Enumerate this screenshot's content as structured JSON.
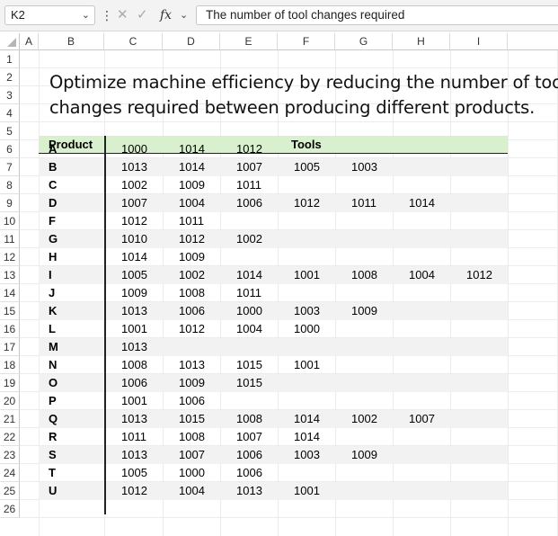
{
  "formula_bar": {
    "name_box": "K2",
    "formula": "The number of tool changes required",
    "icons": [
      "chevron-down-icon",
      "more-vertical-icon",
      "cancel-icon",
      "confirm-icon",
      "function-icon",
      "chevron-down-icon"
    ],
    "fx_label": "fx"
  },
  "columns": [
    "A",
    "B",
    "C",
    "D",
    "E",
    "F",
    "G",
    "H",
    "I"
  ],
  "rows": [
    "1",
    "2",
    "3",
    "4",
    "5",
    "6",
    "7",
    "8",
    "9",
    "10",
    "11",
    "12",
    "13",
    "14",
    "15",
    "16",
    "17",
    "18",
    "19",
    "20",
    "21",
    "22",
    "23",
    "24",
    "25",
    "26"
  ],
  "title_lines": [
    "Optimize machine efficiency by reducing the number of tools",
    "changes required between producing different products."
  ],
  "table": {
    "header_product": "Product",
    "header_tools": "Tools",
    "header_color": "#d9f0ce",
    "stripe_color": "#f2f2f2",
    "rows": [
      {
        "product": "A",
        "tools": [
          "1000",
          "1014",
          "1012"
        ]
      },
      {
        "product": "B",
        "tools": [
          "1013",
          "1014",
          "1007",
          "1005",
          "1003"
        ]
      },
      {
        "product": "C",
        "tools": [
          "1002",
          "1009",
          "1011"
        ]
      },
      {
        "product": "D",
        "tools": [
          "1007",
          "1004",
          "1006",
          "1012",
          "1011",
          "1014"
        ]
      },
      {
        "product": "F",
        "tools": [
          "1012",
          "1011"
        ]
      },
      {
        "product": "G",
        "tools": [
          "1010",
          "1012",
          "1002"
        ]
      },
      {
        "product": "H",
        "tools": [
          "1014",
          "1009"
        ]
      },
      {
        "product": "I",
        "tools": [
          "1005",
          "1002",
          "1014",
          "1001",
          "1008",
          "1004",
          "1012"
        ]
      },
      {
        "product": "J",
        "tools": [
          "1009",
          "1008",
          "1011"
        ]
      },
      {
        "product": "K",
        "tools": [
          "1013",
          "1006",
          "1000",
          "1003",
          "1009"
        ]
      },
      {
        "product": "L",
        "tools": [
          "1001",
          "1012",
          "1004",
          "1000"
        ]
      },
      {
        "product": "M",
        "tools": [
          "1013"
        ]
      },
      {
        "product": "N",
        "tools": [
          "1008",
          "1013",
          "1015",
          "1001"
        ]
      },
      {
        "product": "O",
        "tools": [
          "1006",
          "1009",
          "1015"
        ]
      },
      {
        "product": "P",
        "tools": [
          "1001",
          "1006"
        ]
      },
      {
        "product": "Q",
        "tools": [
          "1013",
          "1015",
          "1008",
          "1014",
          "1002",
          "1007"
        ]
      },
      {
        "product": "R",
        "tools": [
          "1011",
          "1008",
          "1007",
          "1014"
        ]
      },
      {
        "product": "S",
        "tools": [
          "1013",
          "1007",
          "1006",
          "1003",
          "1009"
        ]
      },
      {
        "product": "T",
        "tools": [
          "1005",
          "1000",
          "1006"
        ]
      },
      {
        "product": "U",
        "tools": [
          "1012",
          "1004",
          "1013",
          "1001"
        ]
      }
    ]
  }
}
